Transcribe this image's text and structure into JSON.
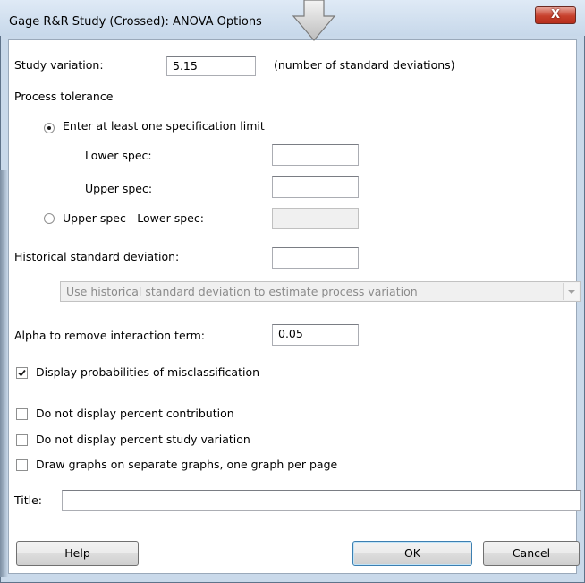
{
  "window": {
    "title": "Gage R&R Study (Crossed): ANOVA Options",
    "close_label": "X"
  },
  "study_variation": {
    "label": "Study variation:",
    "value": "5.15",
    "note": "(number of standard deviations)"
  },
  "process_tolerance": {
    "heading": "Process tolerance",
    "option_spec_limit": "Enter at least one specification limit",
    "lower_spec_label": "Lower spec:",
    "lower_spec_value": "",
    "upper_spec_label": "Upper spec:",
    "upper_spec_value": "",
    "option_range": "Upper spec - Lower spec:",
    "range_value": "",
    "selected": "spec_limit"
  },
  "historical": {
    "label": "Historical standard deviation:",
    "value": "",
    "dropdown_selected": "Use historical standard deviation to estimate process variation"
  },
  "alpha": {
    "label": "Alpha to remove interaction term:",
    "value": "0.05"
  },
  "checkboxes": [
    {
      "label": "Display probabilities of misclassification",
      "checked": true
    },
    {
      "label": "Do not display percent contribution",
      "checked": false
    },
    {
      "label": "Do not display percent study variation",
      "checked": false
    },
    {
      "label": "Draw graphs on separate graphs, one graph per page",
      "checked": false
    }
  ],
  "title_field": {
    "label": "Title:",
    "value": ""
  },
  "buttons": {
    "help": "Help",
    "ok": "OK",
    "cancel": "Cancel"
  },
  "icons": {
    "close": "close-icon",
    "check": "checkmark-icon",
    "dropdown": "chevron-down-icon",
    "callout": "arrow-down-icon"
  },
  "colors": {
    "frame": "#c9d9ea",
    "close_button": "#c7402c",
    "default_button_border": "#3c7fb1"
  }
}
